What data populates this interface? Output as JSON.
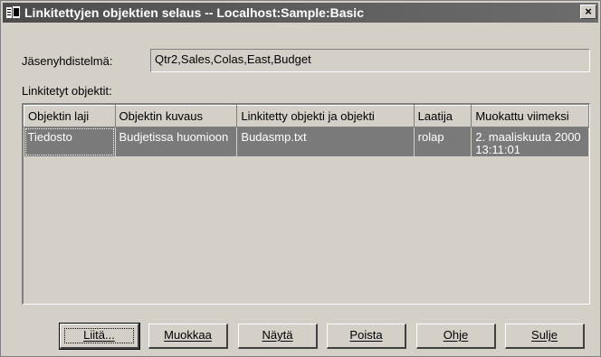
{
  "window": {
    "title": "Linkitettyjen objektien selaus  -- Localhost:Sample:Basic",
    "close_label": "×"
  },
  "member_combination": {
    "label": "Jäsenyhdistelmä:",
    "value": "Qtr2,Sales,Colas,East,Budget"
  },
  "linked_objects": {
    "label": "Linkitetyt objektit:",
    "columns": [
      "Objektin laji",
      "Objektin kuvaus",
      "Linkitetty objekti ja objekti",
      "Laatija",
      "Muokattu viimeksi"
    ],
    "rows": [
      {
        "type": "Tiedosto",
        "description": "Budjetissa huomioon",
        "linked": "Budasmp.txt",
        "author": "rolap",
        "modified": "2. maaliskuuta 2000 13:11:01"
      }
    ]
  },
  "buttons": {
    "attach": "Liitä...",
    "edit": "Muokkaa",
    "view": "Näytä",
    "delete": "Poista",
    "help": "Ohje",
    "close": "Sulje"
  },
  "colors": {
    "title_bar": "#5a5a5a",
    "dialog_bg": "#d4d0c8",
    "selected_row": "#7a7a7a"
  }
}
